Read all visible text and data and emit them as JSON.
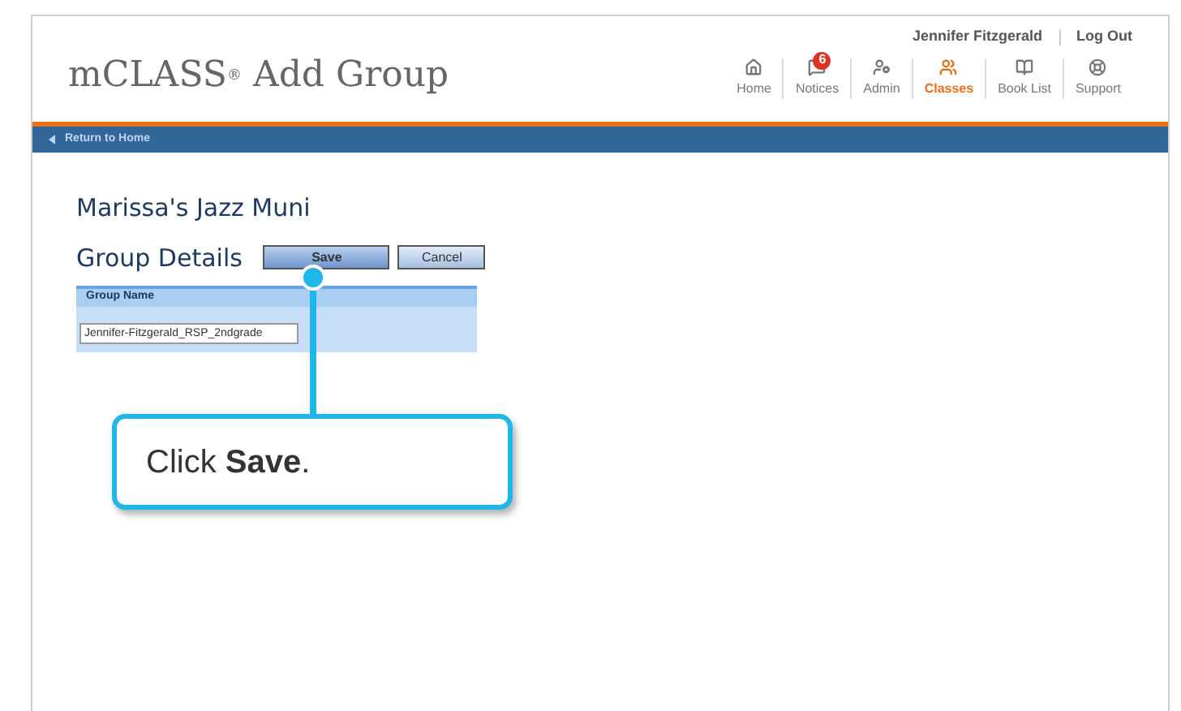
{
  "header": {
    "logo": "mCLASS",
    "logo_mark": "®",
    "title": "Add Group",
    "user": "Jennifer Fitzgerald",
    "logout": "Log Out"
  },
  "nav": [
    {
      "label": "Home",
      "kind": "home",
      "selected": false
    },
    {
      "label": "Notices",
      "kind": "notices",
      "selected": false,
      "badge": "6"
    },
    {
      "label": "Admin",
      "kind": "admin",
      "selected": false
    },
    {
      "label": "Classes",
      "kind": "classes",
      "selected": true
    },
    {
      "label": "Book List",
      "kind": "book",
      "selected": false
    },
    {
      "label": "Support",
      "kind": "support",
      "selected": false
    }
  ],
  "back_link": "Return to Home",
  "school": "Marissa's Jazz Muni",
  "section_title": "Group Details",
  "buttons": [
    {
      "label": "Save",
      "primary": true
    },
    {
      "label": "Cancel",
      "primary": false
    }
  ],
  "table": {
    "columns": [
      "Group Name"
    ],
    "value": "Jennifer-Fitzgerald_RSP_2ndgrade"
  },
  "callout": {
    "prefix": "Click ",
    "bold": "Save",
    "suffix": "."
  }
}
